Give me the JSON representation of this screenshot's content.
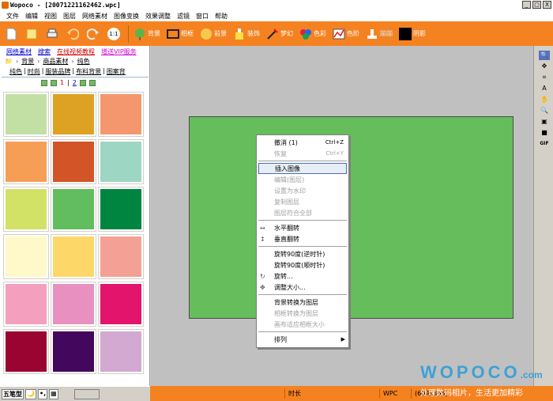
{
  "window": {
    "title": "Wopoco - [20071221162462.wpc]",
    "buttons": [
      "_",
      "▢",
      "X"
    ]
  },
  "menu": [
    "文件",
    "编辑",
    "视图",
    "图层",
    "网络素材",
    "图像变换",
    "效果调整",
    "滤镜",
    "窗口",
    "帮助"
  ],
  "toolbar": {
    "labels": {
      "bg": "背景",
      "frame": "相框",
      "fg": "前景",
      "decor": "装饰",
      "fantasy": "梦幻",
      "color": "色彩",
      "levels": "色阶",
      "stamp": "蹦蹦",
      "shadow": "阴影"
    },
    "zoom": "1:1"
  },
  "nav": {
    "links": [
      "网络素材",
      "搜索",
      "在线视频教程",
      "增送VIP服务"
    ],
    "breadcrumb": [
      "背景",
      "商品素材",
      "纯色"
    ],
    "categories": [
      "纯色",
      "时尚",
      "服装品牌",
      "布料背景",
      "图案背"
    ],
    "pages": [
      "1",
      "2"
    ]
  },
  "swatches": [
    "#c2e0a4",
    "#dea222",
    "#f4976f",
    "#f79e56",
    "#d35426",
    "#9ed6c4",
    "#d2e267",
    "#61bd5d",
    "#008541",
    "#fff9ca",
    "#fdd768",
    "#f4a094",
    "#f49fbe",
    "#e890c0",
    "#e2146c",
    "#9a0430",
    "#43075d",
    "#d3a8d1"
  ],
  "context_menu": {
    "undo": "撤消 (1)",
    "undo_sc": "Ctrl+Z",
    "redo": "恢复",
    "redo_sc": "Ctrl+Y",
    "insert": "插入图像",
    "edit": "编辑(图层)",
    "watermark": "设置为水印",
    "copy": "复制图层",
    "fit": "图层符合全部",
    "fliph": "水平翻转",
    "flipv": "垂直翻转",
    "rotccw": "旋转90度(逆时针)",
    "rotcw": "旋转90度(顺时针)",
    "rotate": "旋转...",
    "resize": "调整大小...",
    "bg2layer": "背景转换为图层",
    "frame2layer": "相框转换为图层",
    "canvasfit": "画布适应相框大小",
    "arrange": "排列"
  },
  "rtools": [
    "🔍",
    "✥",
    "⌗",
    "A",
    "✋",
    "🔍",
    "▣",
    "■",
    "GIF"
  ],
  "bottom": {
    "ime": [
      "五笔型",
      "🌙",
      "•,",
      "▦"
    ]
  },
  "status": {
    "time_label": "时长",
    "fmt": "WPC",
    "size": "(603x366)"
  },
  "watermark": {
    "brand": "WOPOCO",
    "slogan": "处理数码相片，生活更加精彩",
    "url": ".com"
  },
  "colors": {
    "orange": "#f58220",
    "canvas": "#65bd5b"
  }
}
